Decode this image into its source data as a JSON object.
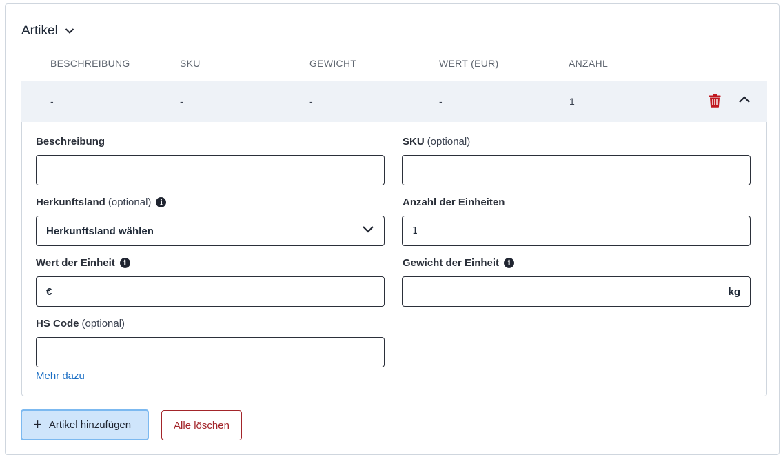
{
  "section": {
    "title": "Artikel"
  },
  "table": {
    "columns": [
      "BESCHREIBUNG",
      "SKU",
      "GEWICHT",
      "WERT (EUR)",
      "ANZAHL"
    ],
    "row": [
      "-",
      "-",
      "-",
      "-",
      "1"
    ]
  },
  "form": {
    "beschreibung": {
      "label": "Beschreibung",
      "value": ""
    },
    "sku": {
      "label": "SKU",
      "optional": "(optional)",
      "value": ""
    },
    "herkunftsland": {
      "label": "Herkunftsland",
      "optional": "(optional)",
      "selected": "Herkunftsland wählen"
    },
    "anzahl": {
      "label": "Anzahl der Einheiten",
      "value": "1"
    },
    "wert": {
      "label": "Wert der Einheit",
      "prefix": "€",
      "value": ""
    },
    "gewicht": {
      "label": "Gewicht der Einheit",
      "suffix": "kg",
      "value": ""
    },
    "hscode": {
      "label": "HS Code",
      "optional": "(optional)",
      "value": ""
    },
    "more_link": "Mehr dazu"
  },
  "buttons": {
    "add": "Artikel hinzufügen",
    "clear": "Alle löschen"
  },
  "colors": {
    "danger": "#c0181f",
    "accent": "#7cb9f0",
    "link": "#1c6fc4"
  },
  "icons": {
    "info": "info-icon",
    "trash": "trash-icon",
    "chevron_up": "chevron-up-icon",
    "chevron_down": "chevron-down-icon"
  }
}
